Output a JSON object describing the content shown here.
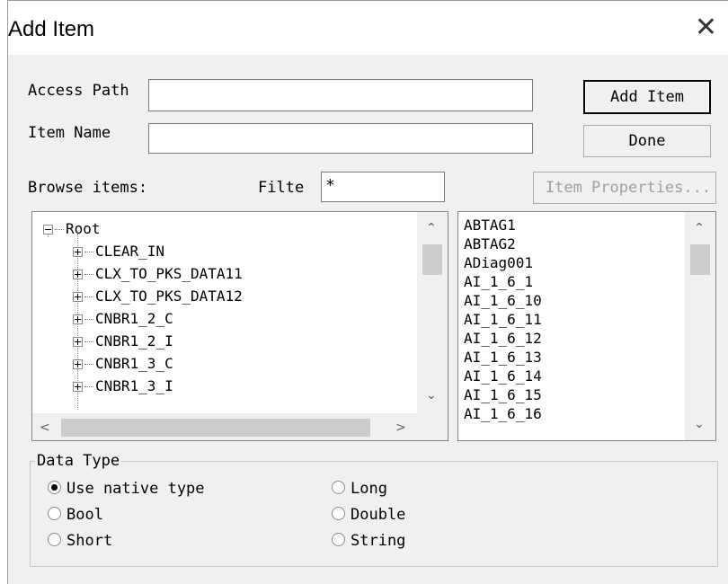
{
  "window": {
    "title": "Add Item",
    "close_glyph": "✕"
  },
  "form": {
    "access_path_label": "Access Path",
    "access_path_value": "",
    "item_name_label": "Item Name",
    "item_name_value": "",
    "browse_label": "Browse items:",
    "filter_label": "Filte",
    "filter_value": "*"
  },
  "buttons": {
    "add_item": "Add Item",
    "done": "Done",
    "item_properties": "Item Properties..."
  },
  "tree": {
    "root": "Root",
    "children": [
      "CLEAR_IN",
      "CLX_TO_PKS_DATA11",
      "CLX_TO_PKS_DATA12",
      "CNBR1_2_C",
      "CNBR1_2_I",
      "CNBR1_3_C",
      "CNBR1_3_I"
    ]
  },
  "items": [
    "ABTAG1",
    "ABTAG2",
    "ADiag001",
    "AI_1_6_1",
    "AI_1_6_10",
    "AI_1_6_11",
    "AI_1_6_12",
    "AI_1_6_13",
    "AI_1_6_14",
    "AI_1_6_15",
    "AI_1_6_16"
  ],
  "data_type": {
    "legend": "Data Type",
    "options": [
      {
        "label": "Use native type",
        "selected": true
      },
      {
        "label": "Bool",
        "selected": false
      },
      {
        "label": "Short",
        "selected": false
      },
      {
        "label": "Long",
        "selected": false
      },
      {
        "label": "Double",
        "selected": false
      },
      {
        "label": "String",
        "selected": false
      }
    ]
  },
  "scroll_glyphs": {
    "up": "⌃",
    "down": "⌄",
    "left": "<",
    "right": ">"
  }
}
